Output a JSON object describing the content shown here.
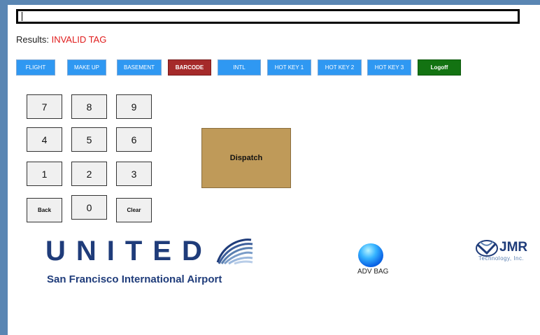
{
  "results": {
    "label": "Results:",
    "value": "INVALID TAG"
  },
  "hotkeys": [
    {
      "label": "FLIGHT"
    },
    {
      "label": "MAKE UP"
    },
    {
      "label": "BASEMENT"
    },
    {
      "label": "BARCODE"
    },
    {
      "label": "INTL"
    },
    {
      "label": "HOT KEY 1"
    },
    {
      "label": "HOT KEY 2"
    },
    {
      "label": "HOT KEY 3"
    },
    {
      "label": "Logoff"
    }
  ],
  "keypad": {
    "k7": "7",
    "k8": "8",
    "k9": "9",
    "k4": "4",
    "k5": "5",
    "k6": "6",
    "k1": "1",
    "k2": "2",
    "k3": "3",
    "back": "Back",
    "k0": "0",
    "clear": "Clear"
  },
  "dispatch_label": "Dispatch",
  "branding": {
    "united": "UNITED",
    "airport": "San Francisco International Airport",
    "jmr": "JMR",
    "jmr_sub": "Technology, Inc."
  },
  "adv_bag_label": "ADV BAG",
  "colors": {
    "hotkey_blue": "#2f98f2",
    "barcode_red": "#a52a2a",
    "logoff_green": "#137312",
    "dispatch_tan": "#bf9a59",
    "invalid_red": "#e01c1c",
    "united_navy": "#1f3c7a"
  }
}
